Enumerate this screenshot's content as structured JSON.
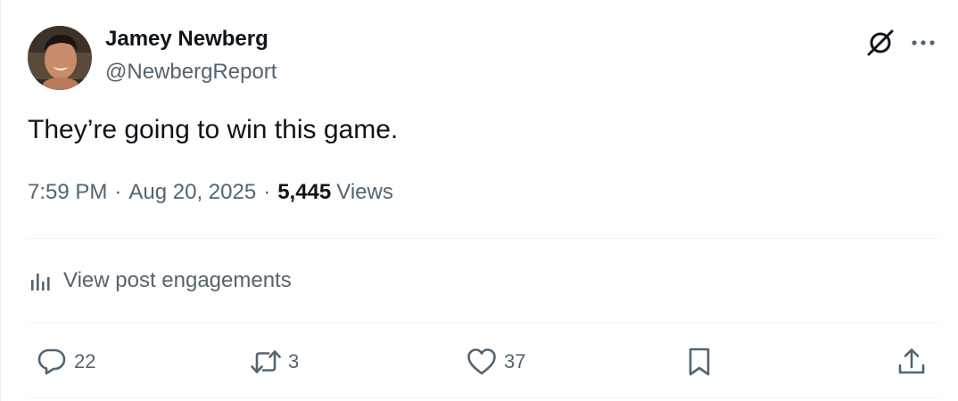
{
  "author": {
    "display_name": "Jamey Newberg",
    "handle": "@NewbergReport",
    "avatar_icon": "profile-photo"
  },
  "header_icons": {
    "grok": "grok-icon",
    "more": "more-icon"
  },
  "post": {
    "text": "They’re going to win this game.",
    "time": "7:59 PM",
    "date": "Aug 20, 2025",
    "views_count": "5,445",
    "views_label": "Views",
    "separator": "·"
  },
  "engagements": {
    "label": "View post engagements",
    "icon": "analytics-icon"
  },
  "actions": {
    "reply": {
      "icon": "reply-icon",
      "count": "22"
    },
    "repost": {
      "icon": "repost-icon",
      "count": "3"
    },
    "like": {
      "icon": "heart-icon",
      "count": "37"
    },
    "bookmark": {
      "icon": "bookmark-icon"
    },
    "share": {
      "icon": "share-icon"
    }
  },
  "colors": {
    "text_primary": "#0f1419",
    "text_secondary": "#536471",
    "divider": "#eff3f4",
    "background": "#ffffff"
  }
}
